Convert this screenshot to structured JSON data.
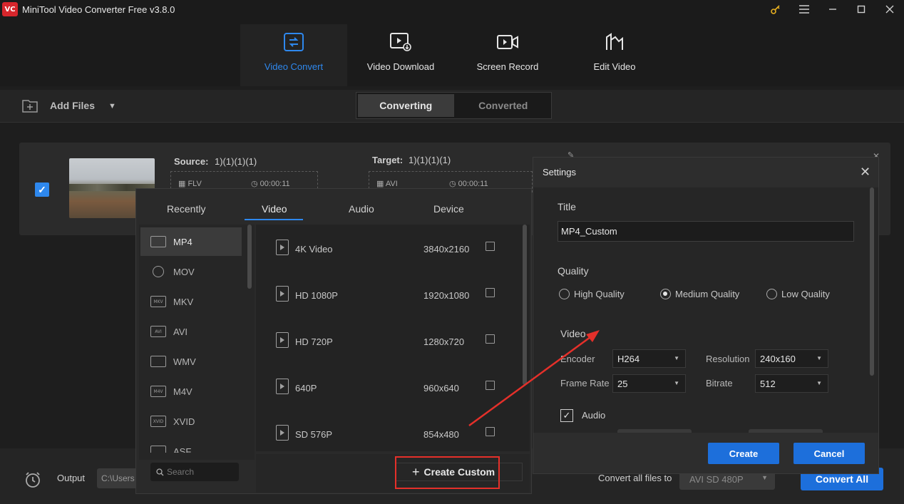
{
  "app": {
    "logo_text": "VC",
    "title": "MiniTool Video Converter Free v3.8.0",
    "window_controls": [
      "key-icon",
      "menu-icon",
      "minimize-icon",
      "maximize-icon",
      "close-icon"
    ]
  },
  "nav": {
    "tabs": [
      {
        "label": "Video Convert",
        "icon": "video-convert-icon",
        "active": true
      },
      {
        "label": "Video Download",
        "icon": "video-download-icon",
        "active": false
      },
      {
        "label": "Screen Record",
        "icon": "screen-record-icon",
        "active": false
      },
      {
        "label": "Edit Video",
        "icon": "edit-video-icon",
        "active": false
      }
    ]
  },
  "toolbar": {
    "add_files": "Add Files",
    "segments": [
      "Converting",
      "Converted"
    ],
    "active_segment": "Converting"
  },
  "file": {
    "checked": true,
    "source_label": "Source:",
    "source_name": "1)(1)(1)(1)",
    "source_format": "FLV",
    "source_duration": "00:00:11",
    "target_label": "Target:",
    "target_name": "1)(1)(1)(1)",
    "target_format": "AVI",
    "target_duration": "00:00:11"
  },
  "format_panel": {
    "tabs": [
      "Recently",
      "Video",
      "Audio",
      "Device"
    ],
    "active_tab": "Video",
    "formats": [
      {
        "name": "MP4",
        "icon": "MP4",
        "active": true
      },
      {
        "name": "MOV",
        "icon": "MOV",
        "active": false
      },
      {
        "name": "MKV",
        "icon": "MKV",
        "active": false
      },
      {
        "name": "AVI",
        "icon": "AVI",
        "active": false
      },
      {
        "name": "WMV",
        "icon": "WMV",
        "active": false
      },
      {
        "name": "M4V",
        "icon": "M4V",
        "active": false
      },
      {
        "name": "XVID",
        "icon": "XVID",
        "active": false
      },
      {
        "name": "ASF",
        "icon": "ASF",
        "active": false
      }
    ],
    "search_placeholder": "Search",
    "presets": [
      {
        "name": "4K Video",
        "resolution": "3840x2160"
      },
      {
        "name": "HD 1080P",
        "resolution": "1920x1080"
      },
      {
        "name": "HD 720P",
        "resolution": "1280x720"
      },
      {
        "name": "640P",
        "resolution": "960x640"
      },
      {
        "name": "SD 576P",
        "resolution": "854x480"
      }
    ],
    "create_custom": "Create Custom"
  },
  "bottom": {
    "output_label": "Output",
    "output_path": "C:\\Users",
    "convert_all_label": "Convert all files to",
    "convert_all_value": "AVI SD 480P",
    "convert_all_button": "Convert All"
  },
  "settings": {
    "title": "Settings",
    "title_label": "Title",
    "title_value": "MP4_Custom",
    "quality_label": "Quality",
    "quality_options": [
      "High Quality",
      "Medium Quality",
      "Low Quality"
    ],
    "quality_selected": "Medium Quality",
    "video_label": "Video",
    "encoder_label": "Encoder",
    "encoder_value": "H264",
    "resolution_label": "Resolution",
    "resolution_value": "240x160",
    "frame_rate_label": "Frame Rate",
    "frame_rate_value": "25",
    "bitrate_label": "Bitrate",
    "bitrate_value": "512",
    "audio_label": "Audio",
    "audio_checked": true,
    "create_button": "Create",
    "cancel_button": "Cancel"
  },
  "colors": {
    "accent": "#2e88ee",
    "primary_button": "#1d6fdb",
    "annotation": "#e5302a",
    "background": "#1e1e1e"
  }
}
